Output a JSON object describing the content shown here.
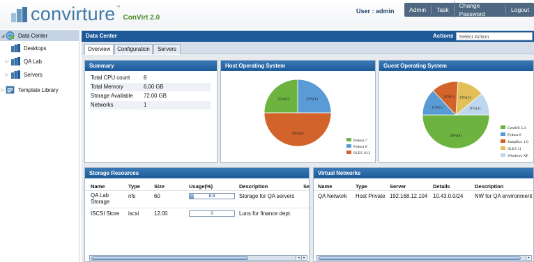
{
  "header": {
    "logo_text": "convirture",
    "logo_tm": "™",
    "product": "ConVirt 2.0",
    "user_label": "User : admin",
    "nav": [
      "Admin",
      "Task",
      "Change Password",
      "Logout"
    ]
  },
  "sidebar": {
    "items": [
      {
        "label": "Data Center",
        "icon": "datacenter-icon"
      },
      {
        "label": "Desktops",
        "icon": "server-group-icon"
      },
      {
        "label": "QA Lab",
        "icon": "server-group-icon"
      },
      {
        "label": "Servers",
        "icon": "server-group-icon"
      },
      {
        "label": "Template Library",
        "icon": "template-library-icon"
      }
    ]
  },
  "main": {
    "title": "Data Center",
    "actions_label": "Actions",
    "select_placeholder": "Select Action",
    "tabs": [
      "Overview",
      "Configuration",
      "Servers"
    ]
  },
  "summary": {
    "title": "Summary",
    "rows": [
      {
        "key": "Total CPU count",
        "value": "8"
      },
      {
        "key": "Total Memory",
        "value": "6.00 GB"
      },
      {
        "key": "Storage Available",
        "value": "72.00 GB"
      },
      {
        "key": "Networks",
        "value": "1"
      }
    ]
  },
  "host_os": {
    "title": "Host Operating System",
    "chart_data": {
      "type": "pie",
      "labels": [
        "Fedora 7",
        "Fedora 8",
        "SLES 10.2"
      ],
      "values": [
        25,
        25,
        50
      ],
      "slice_labels": [
        "25%(1)",
        "25%(1)",
        "50%(2)"
      ],
      "colors": [
        "#6cb33f",
        "#5b9bd5",
        "#d2642b"
      ],
      "legend_position": "bottom-right"
    }
  },
  "guest_os": {
    "title": "Guest Operating System",
    "chart_data": {
      "type": "pie",
      "labels": [
        "CentOS 5.4",
        "Fedora 8",
        "JumpBox 1.0",
        "SLES 11",
        "Windows XP"
      ],
      "values": [
        50,
        13,
        13,
        13,
        11
      ],
      "slice_labels": [
        "50%(4)",
        "13%(1)",
        "13%(1)",
        "13%(1)",
        "11%(1)"
      ],
      "colors": [
        "#6cb33f",
        "#5b9bd5",
        "#d2642b",
        "#e3bf58",
        "#bdd7ee"
      ],
      "legend_position": "right"
    }
  },
  "storage": {
    "title": "Storage Resources",
    "columns": [
      "Name",
      "Type",
      "Size",
      "Usage(%)",
      "Description",
      "Se"
    ],
    "rows": [
      {
        "name": "QA Lab Storage",
        "type": "nfs",
        "size": "60",
        "usage": 8.8,
        "usage_label": "8.8",
        "description": "Storage for QA servers"
      },
      {
        "name": "ISCSI Store",
        "type": "iscsi",
        "size": "12.00",
        "usage": 0,
        "usage_label": "0",
        "description": "Luns for finance dept."
      }
    ],
    "scroll_arrows": "◂ ▸"
  },
  "networks": {
    "title": "Virtual Networks",
    "columns": [
      "Name",
      "Type",
      "Server",
      "Details",
      "Description"
    ],
    "rows": [
      {
        "name": "QA Network",
        "type": "Host Private",
        "server": "192.168.12.104",
        "details": "10.43.0.0/24",
        "description": "NW for QA environment"
      }
    ]
  },
  "colors": {
    "header_blue": "#1e5a9a",
    "accent_green": "#6cb33f",
    "accent_orange": "#d2642b",
    "accent_blue": "#5b9bd5"
  }
}
